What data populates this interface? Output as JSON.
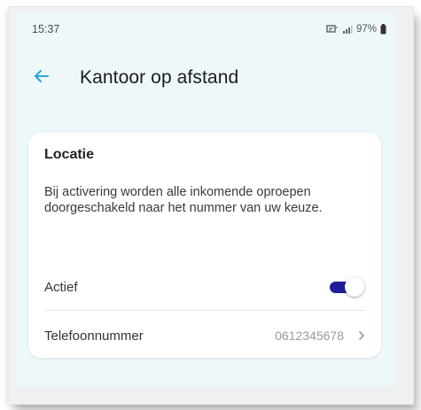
{
  "status_bar": {
    "time": "15:37",
    "battery": "97%"
  },
  "header": {
    "title": "Kantoor op afstand",
    "back_icon": "arrow-left-icon"
  },
  "card": {
    "title": "Locatie",
    "description": "Bij activering worden alle inkomende oproepen doorgeschakeld naar het nummer van uw keuze.",
    "active_row": {
      "label": "Actief",
      "enabled": true
    },
    "phone_row": {
      "label": "Telefoonnummer",
      "value": "0612345678",
      "chevron_icon": "chevron-right-icon"
    }
  },
  "colors": {
    "accent": "#1e1e9a",
    "back_arrow": "#2aa6d8",
    "screen_background": "#eef8fb",
    "card_background": "#ffffff"
  }
}
